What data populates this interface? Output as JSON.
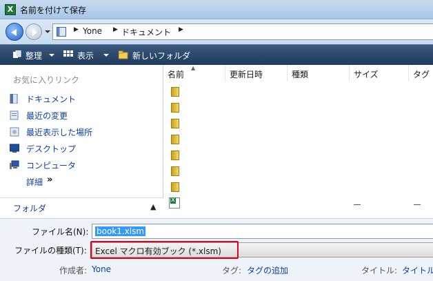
{
  "window": {
    "title": "名前を付けて保存",
    "app_icon": "excel-icon"
  },
  "address": {
    "breadcrumbs": [
      "Yone",
      "ドキュメント"
    ]
  },
  "toolbar": {
    "organize_label": "整理",
    "views_label": "表示",
    "new_folder_label": "新しいフォルダ"
  },
  "navpane": {
    "heading": "お気に入りリンク",
    "links": [
      {
        "label": "ドキュメント",
        "icon": "documents-icon"
      },
      {
        "label": "最近の変更",
        "icon": "recent-changes-icon"
      },
      {
        "label": "最近表示した場所",
        "icon": "recent-places-icon"
      },
      {
        "label": "デスクトップ",
        "icon": "desktop-icon"
      },
      {
        "label": "コンピュータ",
        "icon": "computer-icon"
      }
    ],
    "more_label": "詳細",
    "more_icon": "»",
    "folders_label": "フォルダ"
  },
  "filelist": {
    "columns": [
      "名前",
      "更新日時",
      "種類",
      "サイズ",
      "タグ"
    ],
    "folder_count": 7
  },
  "form": {
    "filename_label": "ファイル名(N):",
    "filename_value": "book1.xlsm",
    "filetype_label": "ファイルの種類(T):",
    "filetype_value": "Excel マクロ有効ブック (*.xlsm)",
    "author_label": "作成者:",
    "author_value": "Yone",
    "tags_label": "タグ:",
    "tags_value": "タグの追加",
    "title_label": "タイトル:",
    "title_value": "タイトル"
  },
  "colors": {
    "highlight_border": "#e0001b",
    "link": "#0c3fa1",
    "selection": "#3399ff"
  }
}
